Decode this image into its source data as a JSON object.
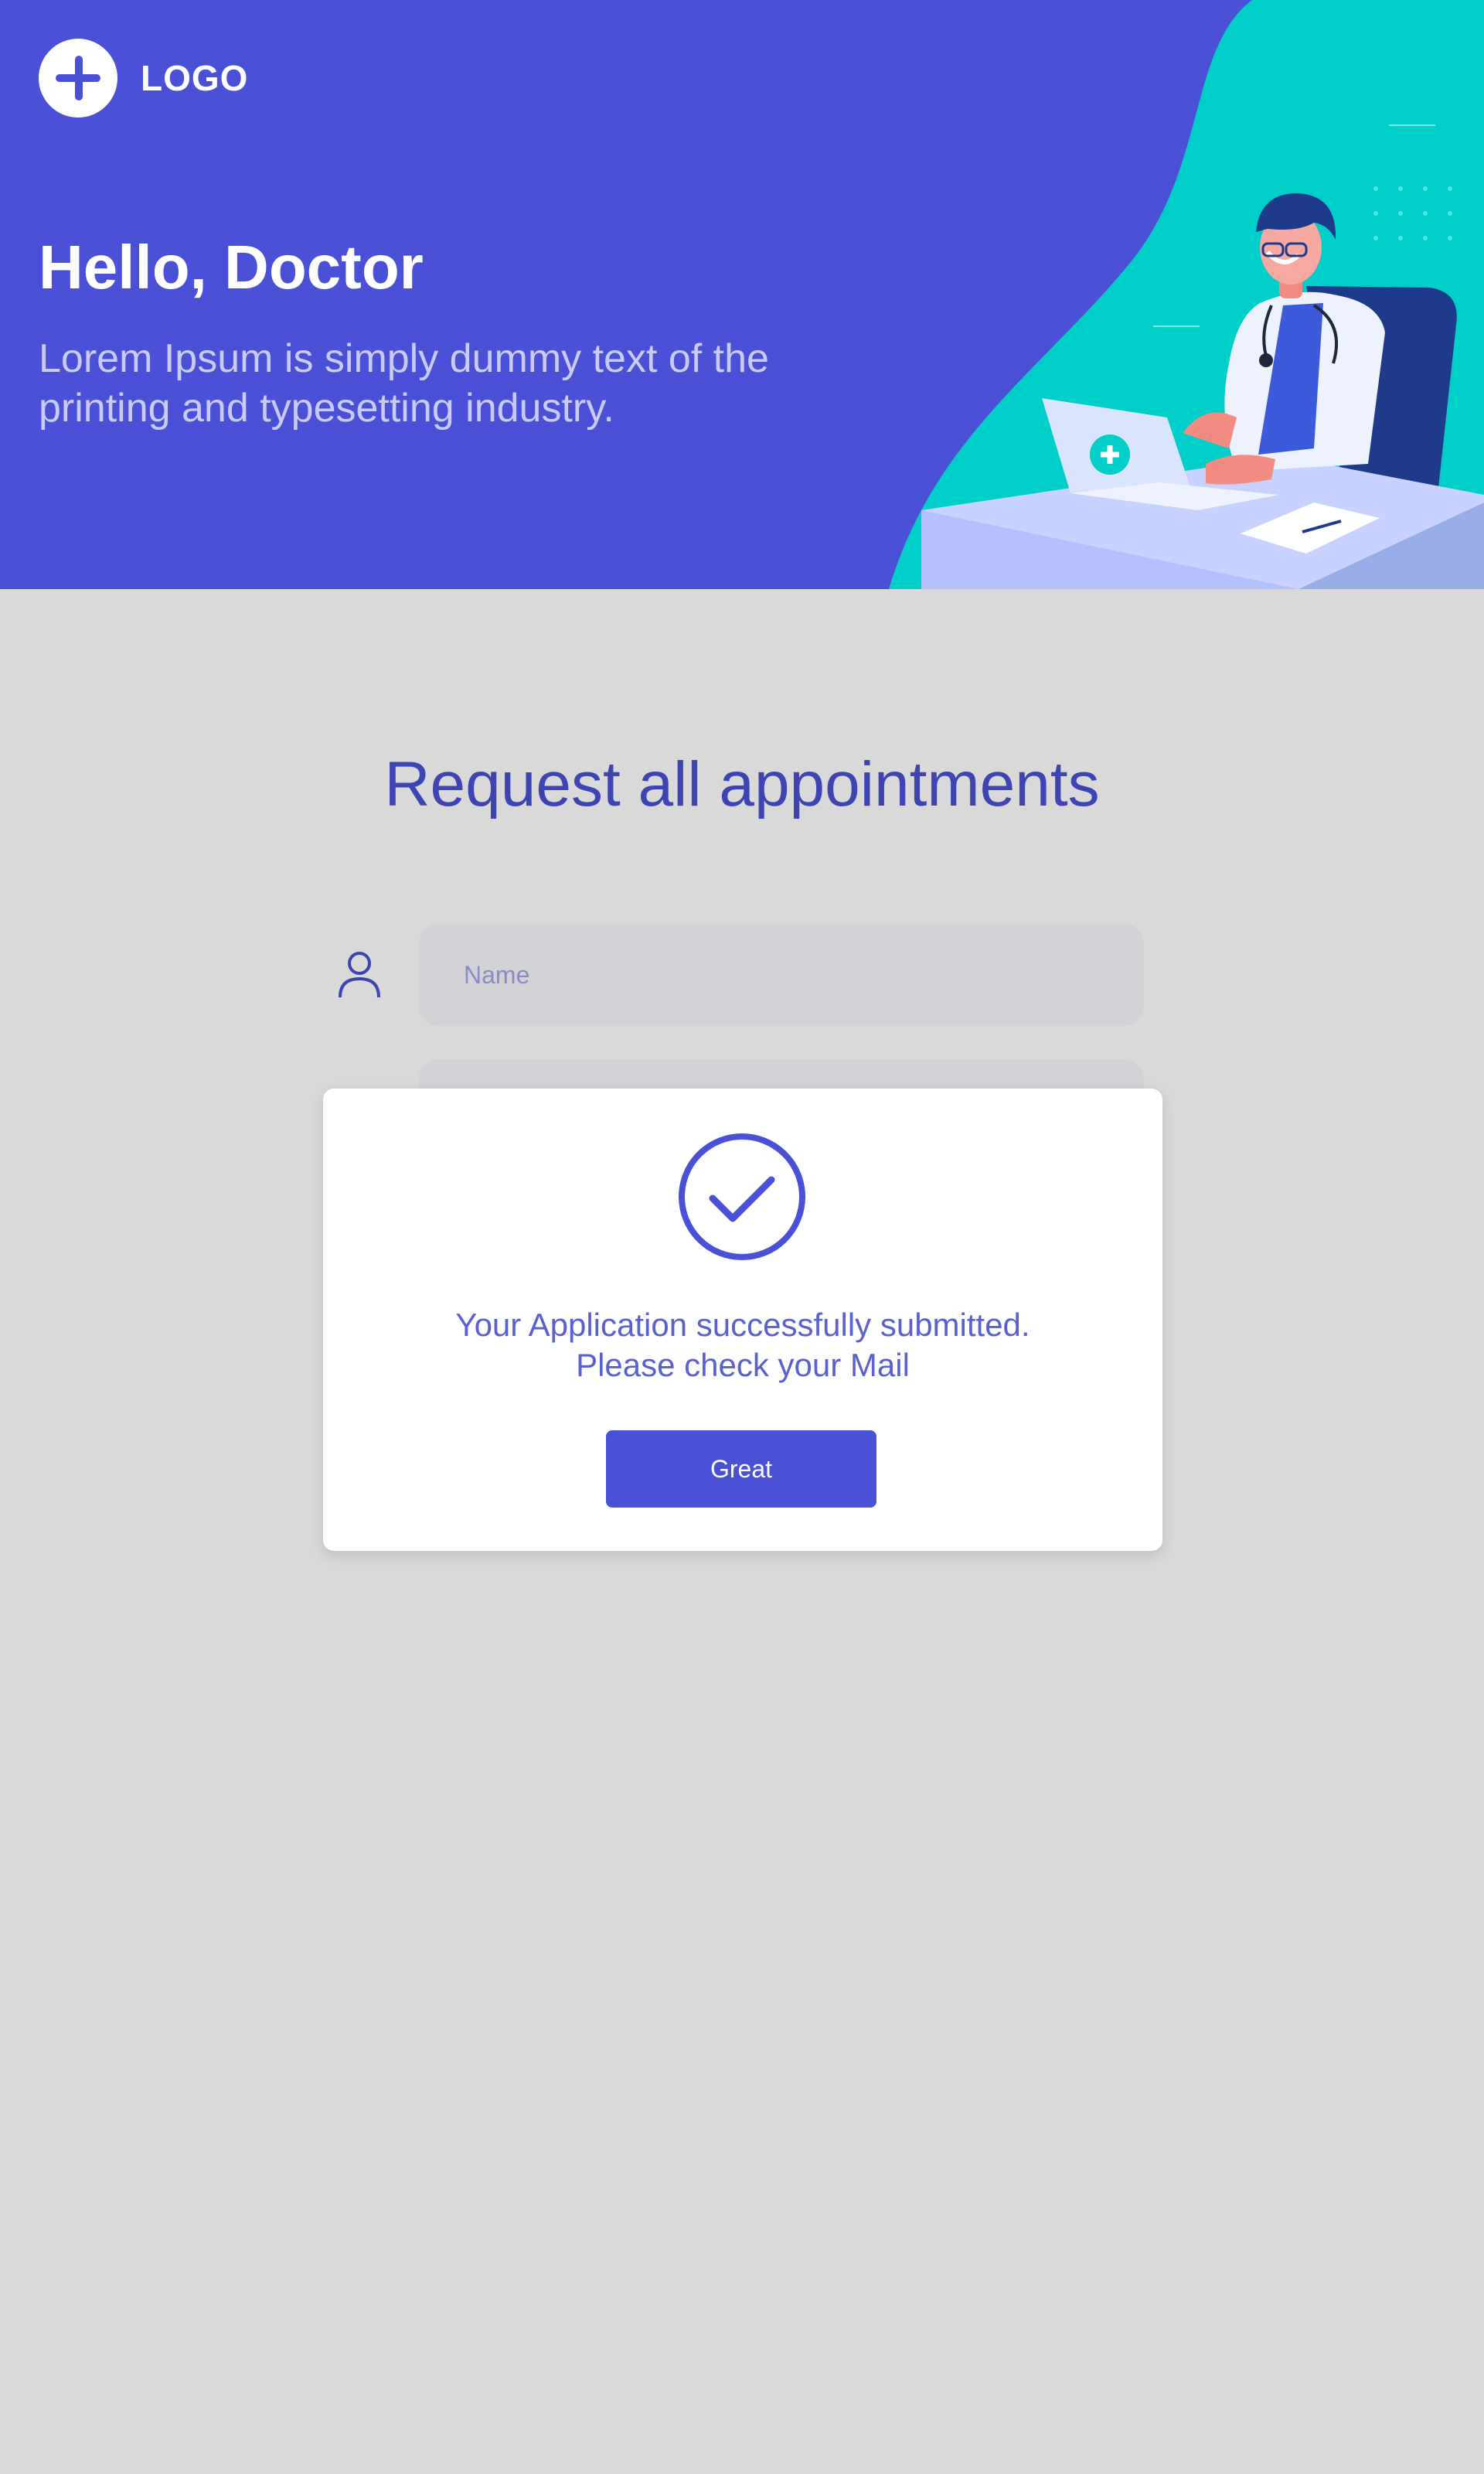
{
  "header": {
    "logo_text": "LOGO",
    "title": "Hello, Doctor",
    "subtitle": "Lorem Ipsum is simply dummy text of the printing and typesetting industry."
  },
  "form": {
    "title": "Request all appointments",
    "name_placeholder": "Name",
    "name_value": ""
  },
  "modal": {
    "message_line1": "Your Application successfully submitted.",
    "message_line2": "Please check your Mail",
    "button_label": "Great"
  },
  "colors": {
    "primary": "#4a51d6",
    "teal": "#00cec8",
    "title": "#3e45b3",
    "background": "#d9d9d9"
  },
  "icons": {
    "logo": "plus-icon",
    "name_field": "user-icon",
    "success": "check-circle-icon"
  }
}
